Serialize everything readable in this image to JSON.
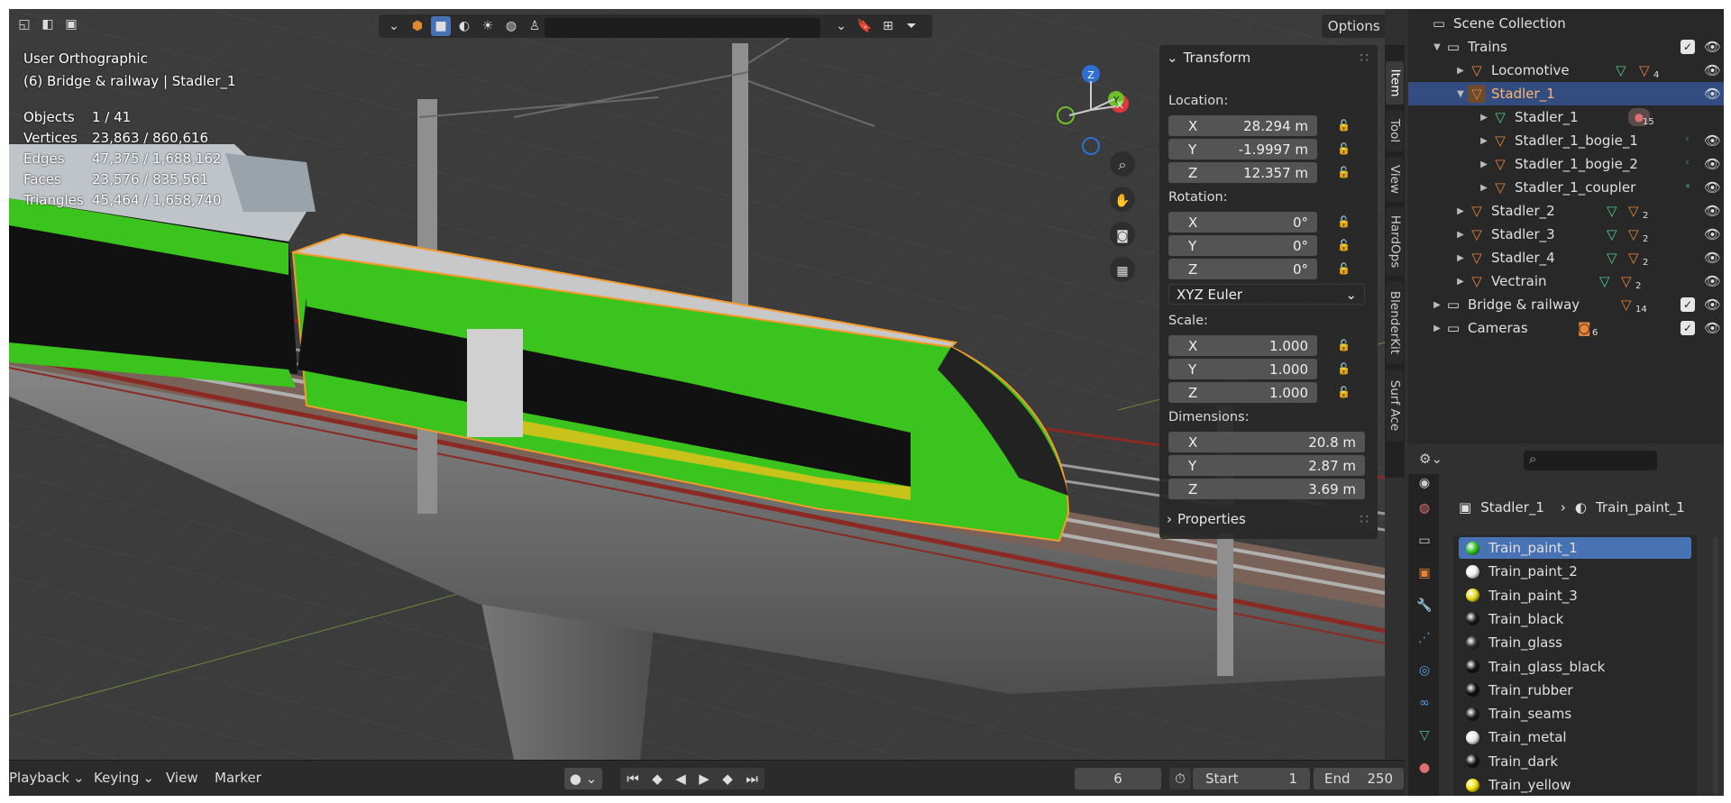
{
  "viewport": {
    "view_name": "User Orthographic",
    "context": "(6) Bridge & railway | Stadler_1",
    "stats": [
      {
        "label": "Objects",
        "value": "1 / 41"
      },
      {
        "label": "Vertices",
        "value": "23,863 / 860,616"
      },
      {
        "label": "Edges",
        "value": "47,375 / 1,688,162"
      },
      {
        "label": "Faces",
        "value": "23,576 / 835,561"
      },
      {
        "label": "Triangles",
        "value": "45,464 / 1,658,740"
      }
    ],
    "options_label": "Options",
    "gizmo": {
      "z": "Z",
      "y": "Y",
      "x": "X"
    }
  },
  "transform_panel": {
    "title": "Transform",
    "location_label": "Location:",
    "location": [
      {
        "axis": "X",
        "value": "28.294 m"
      },
      {
        "axis": "Y",
        "value": "-1.9997 m"
      },
      {
        "axis": "Z",
        "value": "12.357 m"
      }
    ],
    "rotation_label": "Rotation:",
    "rotation": [
      {
        "axis": "X",
        "value": "0°"
      },
      {
        "axis": "Y",
        "value": "0°"
      },
      {
        "axis": "Z",
        "value": "0°"
      }
    ],
    "rotation_mode": "XYZ Euler",
    "scale_label": "Scale:",
    "scale": [
      {
        "axis": "X",
        "value": "1.000"
      },
      {
        "axis": "Y",
        "value": "1.000"
      },
      {
        "axis": "Z",
        "value": "1.000"
      }
    ],
    "dimensions_label": "Dimensions:",
    "dimensions": [
      {
        "axis": "X",
        "value": "20.8 m"
      },
      {
        "axis": "Y",
        "value": "2.87 m"
      },
      {
        "axis": "Z",
        "value": "3.69 m"
      }
    ],
    "properties_title": "Properties"
  },
  "side_tabs": [
    "Item",
    "Tool",
    "View",
    "HardOps",
    "BlenderKit",
    "Surf Ace"
  ],
  "timeline": {
    "playback": "Playback",
    "keying": "Keying",
    "view": "View",
    "marker": "Marker",
    "current_frame": "6",
    "start_label": "Start",
    "start": "1",
    "end_label": "End",
    "end": "250"
  },
  "outliner": {
    "items": [
      {
        "label": "Scene Collection"
      },
      {
        "label": "Trains"
      },
      {
        "label": "Locomotive",
        "count": "4"
      },
      {
        "label": "Stadler_1"
      },
      {
        "label": "Stadler_1",
        "count": "15"
      },
      {
        "label": "Stadler_1_bogie_1"
      },
      {
        "label": "Stadler_1_bogie_2"
      },
      {
        "label": "Stadler_1_coupler"
      },
      {
        "label": "Stadler_2",
        "count": "2"
      },
      {
        "label": "Stadler_3",
        "count": "2"
      },
      {
        "label": "Stadler_4",
        "count": "2"
      },
      {
        "label": "Vectrain",
        "count": "2"
      },
      {
        "label": "Bridge & railway",
        "count": "14"
      },
      {
        "label": "Cameras",
        "count": "6"
      }
    ]
  },
  "properties": {
    "breadcrumb_object": "Stadler_1",
    "breadcrumb_material": "Train_paint_1",
    "materials": [
      {
        "name": "Train_paint_1",
        "color": "#34c424"
      },
      {
        "name": "Train_paint_2",
        "color": "#f0f0f0"
      },
      {
        "name": "Train_paint_3",
        "color": "#e6d81a"
      },
      {
        "name": "Train_black",
        "color": "#1a1a1a"
      },
      {
        "name": "Train_glass",
        "color": "#2a2a2a"
      },
      {
        "name": "Train_glass_black",
        "color": "#151515"
      },
      {
        "name": "Train_rubber",
        "color": "#111111"
      },
      {
        "name": "Train_seams",
        "color": "#1c1c1c"
      },
      {
        "name": "Train_metal",
        "color": "#e8e8e8"
      },
      {
        "name": "Train_dark",
        "color": "#181818"
      },
      {
        "name": "Train_yellow",
        "color": "#f2e000"
      }
    ]
  },
  "colors": {
    "selection": "#4772b3",
    "outline": "#f39a2b",
    "train_green": "#3cc41e",
    "train_yellow": "#c9c21a"
  }
}
